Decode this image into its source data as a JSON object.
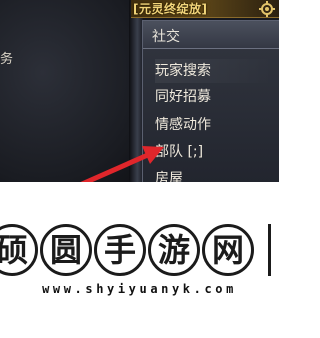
{
  "game": {
    "banner_text": "[元灵终绽放]",
    "left_panel_text": "务",
    "social_menu": {
      "title": "社交",
      "items": [
        {
          "label": "玩家搜索"
        },
        {
          "label": "同好招募"
        },
        {
          "label": "情感动作"
        },
        {
          "label": "部队 [;]"
        },
        {
          "label": "房屋"
        }
      ]
    }
  },
  "watermark": {
    "chars": [
      "硕",
      "圆",
      "手",
      "游",
      "网"
    ],
    "url": "www.shyiyuanyk.com"
  },
  "colors": {
    "menu_text": "#efe9dc",
    "banner_gold": "#f2d57a",
    "arrow_red": "#e0262b"
  }
}
